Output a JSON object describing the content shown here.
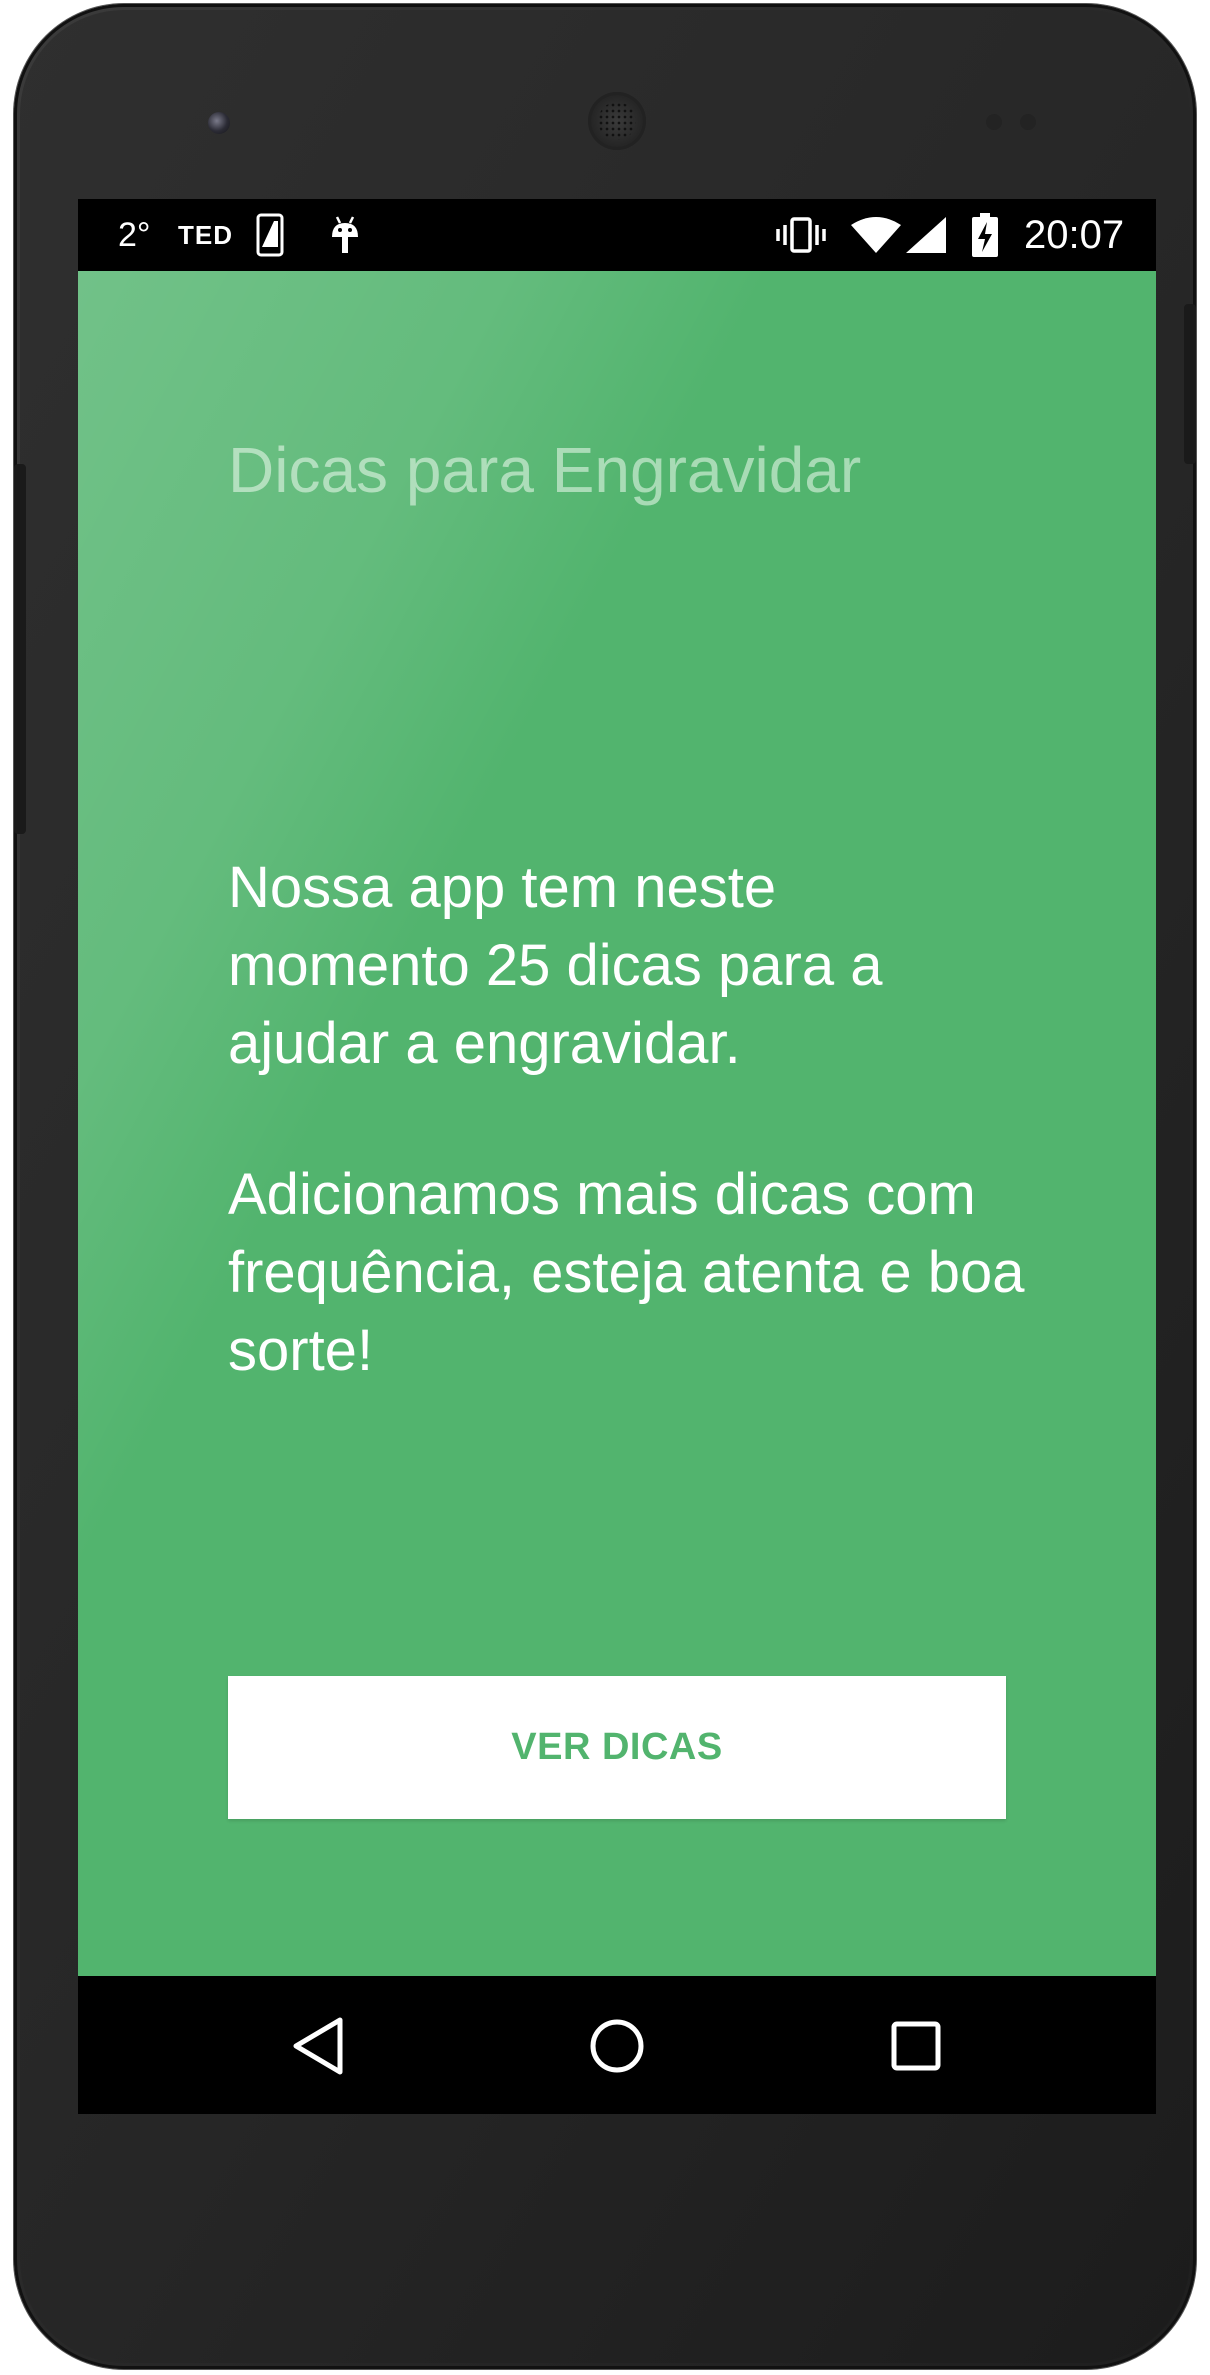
{
  "status_bar": {
    "temperature": "2°",
    "ted_label": "TED",
    "time": "20:07",
    "icons": [
      "phone-icon",
      "android-icon",
      "vibrate-icon",
      "wifi-icon",
      "signal-icon",
      "battery-charging-icon"
    ]
  },
  "app": {
    "title": "Dicas para Engravidar",
    "message_1": "Nossa app tem neste momento 25 dicas para a ajudar a engravidar.",
    "message_2": "Adicionamos mais dicas com frequência, esteja atenta e boa sorte!",
    "button_label": "VER DICAS",
    "background_color": "#52b46e",
    "button_text_color": "#52b46e"
  },
  "nav_bar": {
    "icons": [
      "back-icon",
      "home-icon",
      "recents-icon"
    ]
  }
}
